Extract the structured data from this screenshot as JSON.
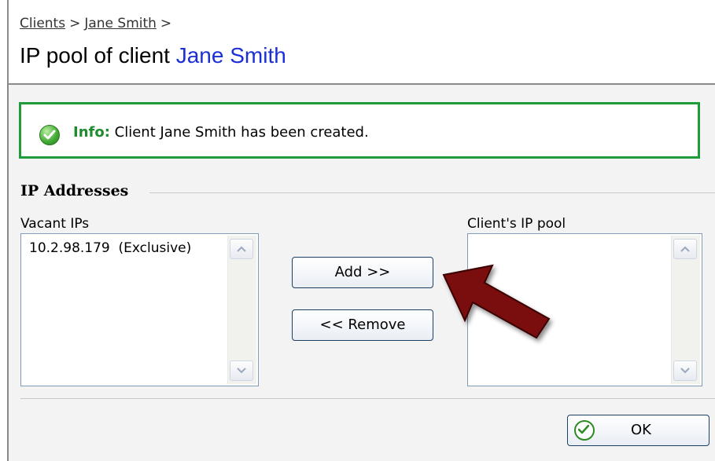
{
  "breadcrumb": {
    "items": [
      "Clients",
      "Jane Smith"
    ],
    "separator": ">"
  },
  "title": {
    "prefix": "IP pool of client ",
    "client_name": "Jane Smith"
  },
  "info": {
    "label": "Info:",
    "message": "Client Jane Smith has been created."
  },
  "section": {
    "title": "IP Addresses"
  },
  "vacant": {
    "label": "Vacant IPs",
    "items": [
      "10.2.98.179  (Exclusive)"
    ]
  },
  "pool": {
    "label": "Client's IP pool",
    "items": []
  },
  "buttons": {
    "add": "Add >>",
    "remove": "<< Remove",
    "ok": "OK"
  },
  "colors": {
    "accent_name": "#1a2fd6",
    "info_border": "#1f9b3a",
    "arrow": "#7a0f0f"
  },
  "icons": {
    "info": "check-circle-icon",
    "ok": "check-circle-outline-icon",
    "annotation": "red-arrow-icon"
  }
}
